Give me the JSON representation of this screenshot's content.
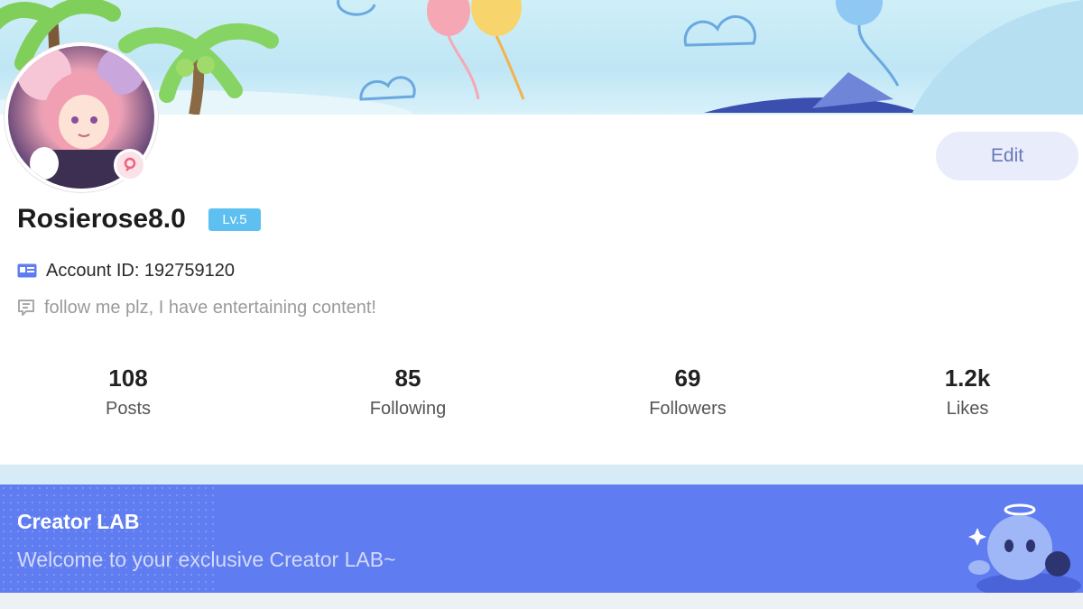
{
  "profile": {
    "username": "Rosierose8.0",
    "level": "Lv.5",
    "account_label": "Account ID: 192759120",
    "bio": "follow me plz, I have entertaining content!",
    "edit_label": "Edit",
    "avatar_icon": "avatar-image",
    "gender_icon": "female-icon"
  },
  "stats": [
    {
      "value": "108",
      "label": "Posts"
    },
    {
      "value": "85",
      "label": "Following"
    },
    {
      "value": "69",
      "label": "Followers"
    },
    {
      "value": "1.2k",
      "label": "Likes"
    }
  ],
  "creator_lab": {
    "title": "Creator LAB",
    "subtitle": "Welcome to your exclusive Creator LAB~"
  },
  "colors": {
    "accent": "#5f7cf0",
    "level_badge": "#5ec0f0",
    "edit_button_bg": "#e9ecfb"
  }
}
